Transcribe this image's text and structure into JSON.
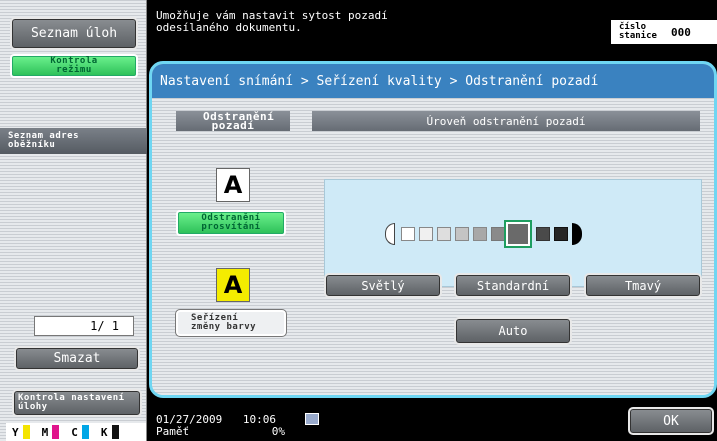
{
  "left_panel": {
    "job_list_button": "Seznam úloh",
    "mode_check_button": "Kontrola režimu",
    "broadcast_list_label": "Seznam adres oběžníku",
    "page_counter": "1/ 1",
    "delete_button": "Smazat",
    "job_settings_button": "Kontrola nastavení úlohy",
    "toner": [
      {
        "label": "Y",
        "color": "#f4e400"
      },
      {
        "label": "M",
        "color": "#e0148c"
      },
      {
        "label": "C",
        "color": "#00a6e6"
      },
      {
        "label": "K",
        "color": "#111111"
      }
    ]
  },
  "header": {
    "message": "Umožňuje vám nastavit sytost pozadí odesílaného dokumentu.",
    "station_label": "číslo stanice",
    "station_value": "000"
  },
  "breadcrumb": "Nastavení snímání > Seřízení kvality > Odstranění pozadí",
  "method_panel": {
    "title": "Odstranění pozadí",
    "options": [
      {
        "icon_letter": "A",
        "label": "Odstranění prosvítání",
        "selected": true
      },
      {
        "icon_letter": "A",
        "label": "Seřízení změny barvy",
        "selected": false
      }
    ]
  },
  "level_panel": {
    "title": "Úroveň odstranění pozadí",
    "levels": 9,
    "selected_level": 7,
    "buttons": {
      "light": "Světlý",
      "standard": "Standardní",
      "dark": "Tmavý",
      "auto": "Auto"
    }
  },
  "status_bar": {
    "date": "01/27/2009",
    "time": "10:06",
    "memory_label": "Paměť",
    "memory_value": "0%",
    "ok_button": "OK"
  },
  "colors": {
    "accent_green": "#2bbf57",
    "panel_header": "#3a82c0",
    "highlight_border": "#6fd6f2"
  }
}
